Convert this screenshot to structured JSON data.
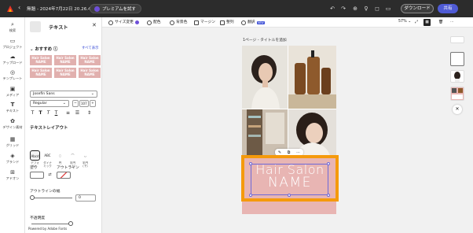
{
  "topbar": {
    "title": "無題 - 2024年7月22日 20.26.45",
    "premium_label": "プレミアムを試す",
    "download_label": "ダウンロード",
    "share_label": "共有"
  },
  "rail": [
    {
      "label": "検索",
      "icon": "search-icon"
    },
    {
      "label": "プロジェクト",
      "icon": "folder-icon"
    },
    {
      "label": "アップロード",
      "icon": "upload-icon"
    },
    {
      "label": "テンプレート",
      "icon": "template-icon"
    },
    {
      "label": "メディア",
      "icon": "media-icon"
    },
    {
      "label": "テキスト",
      "icon": "text-icon"
    },
    {
      "label": "デザイン素材",
      "icon": "design-elements-icon"
    },
    {
      "label": "グリッド",
      "icon": "grid-icon"
    },
    {
      "label": "ブランド",
      "icon": "brand-icon"
    },
    {
      "label": "アドオン",
      "icon": "addons-icon"
    }
  ],
  "panel": {
    "title": "テキスト",
    "recommended": "おすすめ",
    "see_all": "すべて表示",
    "presets": [
      "Hair Salon NAME",
      "Hair Salon NAME",
      "Hair Salon NAME",
      "Hair Salon NAME",
      "Hair Salon NAME",
      "Hair Salon NAME"
    ],
    "font": "Josefin Sans",
    "weight": "Regular",
    "size": "107",
    "layout_title": "テキストレイアウト",
    "layouts": [
      "デフォルト",
      "ダイナミック",
      "円",
      "半円(上)",
      "半円(下)"
    ],
    "fill_label": "塗り",
    "outline_label": "アウトライン",
    "outline_width_label": "アウトラインの幅",
    "outline_width_value": "0",
    "opacity_label": "不透明度",
    "powered": "Powered by Adobe Fonts"
  },
  "toolbar": {
    "items": [
      "サイズ変更",
      "配色",
      "背景色",
      "マージン",
      "整列",
      "翻訳"
    ],
    "new_badge": "NEW",
    "zoom": "57%"
  },
  "canvas": {
    "page_hint": "1ページ - タイトルを追加",
    "headline1": "Hair Salon",
    "headline2": "NAME"
  },
  "colors": {
    "accent_orange": "#f59a0c",
    "selection": "#6d69d8",
    "pink": "#e8b5b3",
    "brand_blue": "#4f5bd5"
  }
}
